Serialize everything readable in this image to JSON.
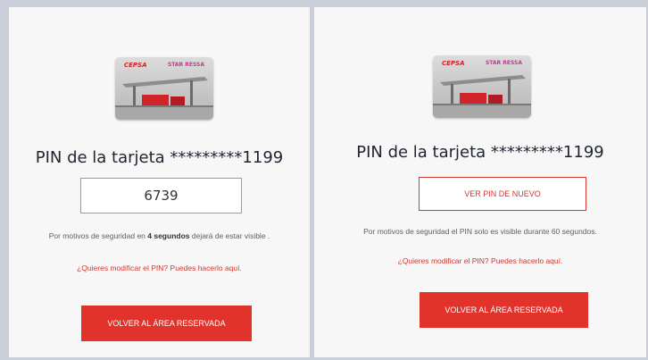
{
  "left_panel": {
    "card": {
      "brand": "CEPSA",
      "brand2": "STAR RESSA"
    },
    "title": "PIN de la tarjeta *********1199",
    "pin_value": "6739",
    "note_before": "Por motivos de seguridad en ",
    "note_bold": "4 segundos",
    "note_after": " dejará de estar visible .",
    "modify_link": "¿Quieres modificar el PIN? Puedes hacerlo aquí.",
    "back_button": "VOLVER AL ÁREA RESERVADA"
  },
  "right_panel": {
    "card": {
      "brand": "CEPSA",
      "brand2": "STAR RESSA"
    },
    "title": "PIN de la tarjeta *********1199",
    "ver_button": "VER PIN DE NUEVO",
    "note": "Por motivos de seguridad el PIN solo es visible durante 60 segundos.",
    "modify_link": "¿Quieres modificar el PIN? Puedes hacerlo aquí.",
    "back_button": "VOLVER AL ÁREA RESERVADA"
  },
  "colors": {
    "accent": "#e1322b",
    "text": "#1f2430",
    "background": "#c9ced8"
  }
}
